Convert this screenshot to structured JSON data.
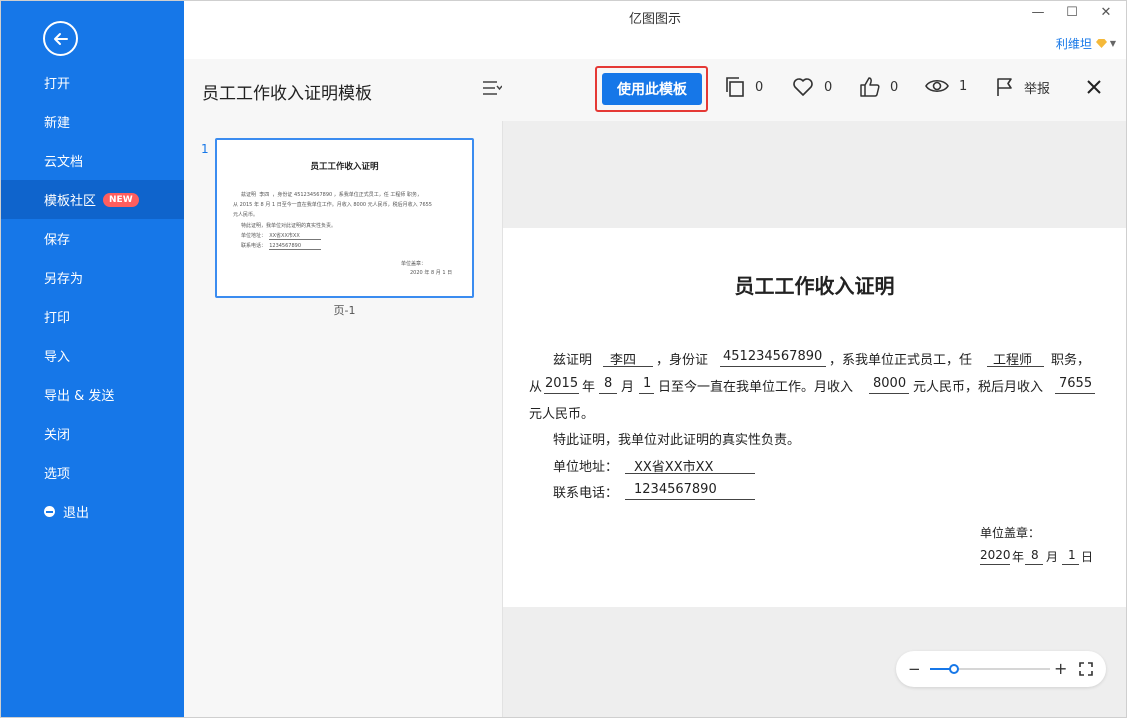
{
  "window": {
    "title": "亿图图示",
    "controls": [
      "—",
      "☐",
      "✕"
    ],
    "user_name": "利维坦",
    "vip_color": "#f5b93a"
  },
  "sidebar": {
    "bg_color": "#1677e8",
    "items": [
      {
        "label": "打开"
      },
      {
        "label": "新建"
      },
      {
        "label": "云文档"
      },
      {
        "label": "模板社区",
        "badge": "NEW",
        "active": true
      },
      {
        "label": "保存"
      },
      {
        "label": "另存为"
      },
      {
        "label": "打印"
      },
      {
        "label": "导入"
      },
      {
        "label": "导出 & 发送"
      },
      {
        "label": "关闭"
      },
      {
        "label": "选项"
      },
      {
        "label": "退出"
      }
    ]
  },
  "header": {
    "title": "员工工作收入证明模板",
    "use_template_label": "使用此模板",
    "copies_count": "0",
    "favorites_count": "0",
    "likes_count": "0",
    "views_count": "1",
    "report_label": "举报"
  },
  "thumbnails": {
    "number": "1",
    "page_label": "页-1"
  },
  "document": {
    "title": "员工工作收入证明",
    "prefix_1": "兹证明",
    "name": "李四",
    "id_label": "，身份证",
    "id_number": "451234567890",
    "company_text": "，系我单位正式员工，任",
    "position": "工程师",
    "duty_text": "职务，",
    "from_text": "从",
    "year": "2015",
    "year_unit": "年",
    "month": "8",
    "month_unit": "月",
    "day": "1",
    "work_text": "日至今一直在我单位工作。月收入",
    "income": "8000",
    "income_text": "元人民币，税后月收入",
    "after_tax": "7655",
    "currency_text": "元人民币。",
    "statement": "特此证明，我单位对此证明的真实性负责。",
    "address_label": "单位地址：",
    "address": "XX省XX市XX",
    "phone_label": "联系电话：",
    "phone": "1234567890",
    "seal_label": "单位盖章：",
    "sign_year": "2020",
    "sign_year_unit": "年",
    "sign_month": "8",
    "sign_month_unit": "月",
    "sign_day": "1",
    "sign_day_unit": "日"
  },
  "mini": {
    "line1_a": "兹证明",
    "line1_b": "，身份证",
    "line1_c": "，系我单位正式员工，任",
    "line1_d": "职务，",
    "line2_a": "从",
    "line2_b": "年",
    "line2_c": "月",
    "line2_d": "日至今一直在我单位工作。月收入",
    "line2_e": "元人民币，税后月收入",
    "line3": "元人民币。",
    "seal_label": "单位盖章：",
    "sign_year_unit": "年",
    "sign_month_unit": "月",
    "sign_day_unit": "日"
  },
  "zoom": {
    "level": 0.2
  }
}
